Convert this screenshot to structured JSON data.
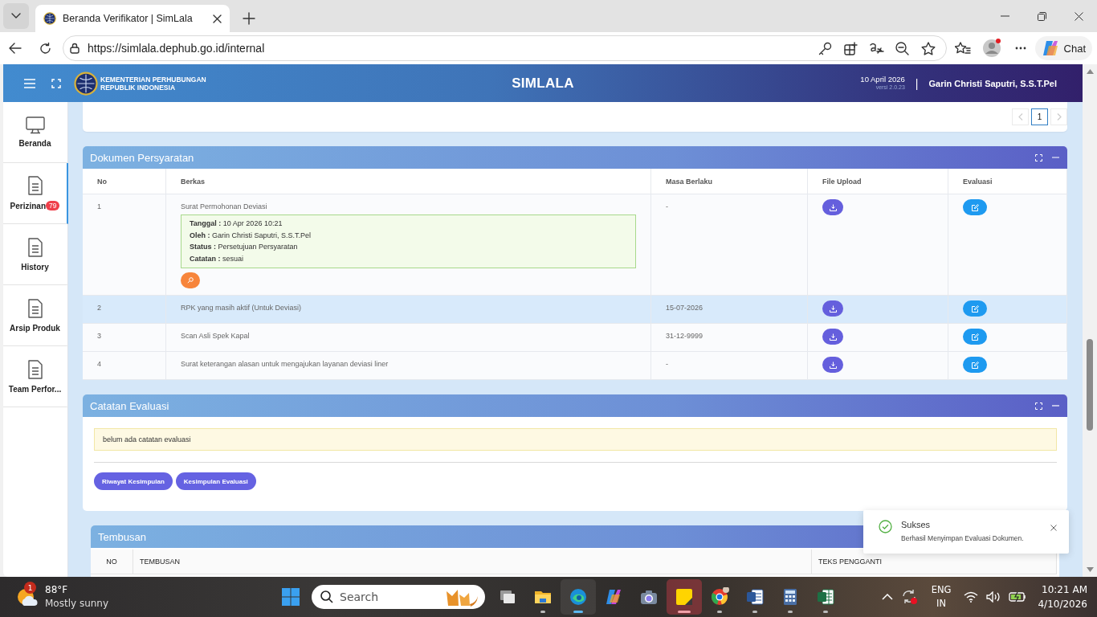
{
  "browser": {
    "tab_title": "Beranda Verifikator | SimLala",
    "url": "https://simlala.dephub.go.id/internal",
    "chat_label": "Chat"
  },
  "header": {
    "org_lines": [
      "KEMENTERIAN PERHUBUNGAN",
      "REPUBLIK INDONESIA"
    ],
    "app_name": "SIMLALA",
    "date": "10 April 2026",
    "version": "versi 2.0.23",
    "separator": "|",
    "user": "Garin Christi Saputri, S.S.T.Pel"
  },
  "sidebar": {
    "items": [
      {
        "label": "Beranda",
        "kind": "monitor",
        "selected": false
      },
      {
        "label": "Perizinan",
        "kind": "document",
        "badge": "79",
        "selected": true
      },
      {
        "label": "History",
        "kind": "document",
        "selected": false
      },
      {
        "label": "Arsip Produk",
        "kind": "document",
        "selected": false
      },
      {
        "label": "Team Perfor...",
        "kind": "document",
        "selected": false
      }
    ]
  },
  "pagination": {
    "prev_disabled": true,
    "next_disabled": true,
    "pages": [
      {
        "label": "1",
        "selected": true
      }
    ]
  },
  "documents": {
    "title": "Dokumen Persyaratan",
    "columns": [
      "No",
      "Berkas",
      "Masa Berlaku",
      "File Upload",
      "Evaluasi"
    ],
    "rows": [
      {
        "no": "1",
        "berkas": "Surat Permohonan Deviasi",
        "masa_berlaku": "-",
        "hovered": false,
        "review": [
          "**Tanggal :** 10 Apr 2026 10:21",
          "**Oleh :** Garin Christi Saputri, S.S.T.Pel",
          "**Status :** Persetujuan Persyaratan",
          "**Catatan :** sesuai"
        ]
      },
      {
        "no": "2",
        "berkas": "RPK yang masih aktif (Untuk Deviasi)",
        "masa_berlaku": "15-07-2026",
        "hovered": true
      },
      {
        "no": "3",
        "berkas": "Scan Asli Spek Kapal",
        "masa_berlaku": "31-12-9999",
        "hovered": false
      },
      {
        "no": "4",
        "berkas": "Surat keterangan alasan untuk mengajukan layanan deviasi liner",
        "masa_berlaku": "-",
        "hovered": false
      }
    ]
  },
  "evaluation_notes": {
    "title": "Catatan Evaluasi",
    "message": "belum ada catatan evaluasi",
    "buttons": [
      "Riwayat Kesimpulan",
      "Kesimpulan Evaluasi"
    ]
  },
  "tembusan": {
    "title": "Tembusan",
    "columns": [
      "NO",
      "TEMBUSAN",
      "TEKS PENGGANTI"
    ]
  },
  "toast": {
    "title": "Sukses",
    "message": "Berhasil Menyimpan Evaluasi Dokumen."
  },
  "taskbar": {
    "weather": {
      "badge": "1",
      "temperature": "88°F",
      "condition": "Mostly sunny"
    },
    "search_placeholder": "Search",
    "apps": [
      {
        "kind": "taskview",
        "running": false,
        "focused": false,
        "flashing": false
      },
      {
        "kind": "folder",
        "running": true,
        "focused": false,
        "flashing": false
      },
      {
        "kind": "edge",
        "running": true,
        "focused": true,
        "flashing": false
      },
      {
        "kind": "copilot",
        "running": false,
        "focused": false,
        "flashing": false
      },
      {
        "kind": "camera",
        "running": false,
        "focused": false,
        "flashing": false
      },
      {
        "kind": "notes",
        "running": true,
        "focused": false,
        "flashing": true
      },
      {
        "kind": "chrome",
        "running": true,
        "focused": false,
        "flashing": false
      },
      {
        "kind": "word",
        "running": true,
        "focused": false,
        "flashing": false
      },
      {
        "kind": "calculator",
        "running": true,
        "focused": false,
        "flashing": false
      },
      {
        "kind": "excel",
        "running": true,
        "focused": false,
        "flashing": false
      }
    ],
    "language": "ENG",
    "region": "IN",
    "time": "10:21 AM",
    "date": "4/10/2026"
  }
}
